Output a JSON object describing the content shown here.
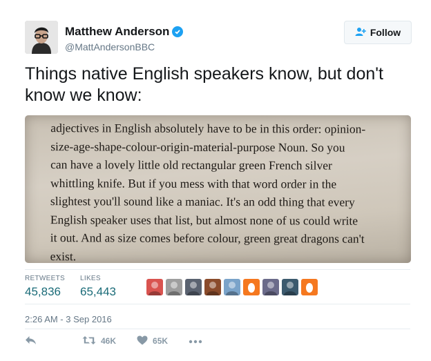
{
  "user": {
    "name": "Matthew Anderson",
    "handle": "@MattAndersonBBC",
    "follow_label": "Follow"
  },
  "tweet": {
    "text": "Things native English speakers know, but don't know we know:"
  },
  "photo": {
    "lines": [
      "adjectives in English absolutely have to be in this order: opinion-",
      "size-age-shape-colour-origin-material-purpose Noun. So you",
      "can have a lovely little old rectangular green French silver",
      "whittling knife. But if you mess with that word order in the",
      "slightest you'll sound like a maniac. It's an odd thing that every",
      "English speaker uses that list, but almost none of us could write",
      "it out. And as size comes before colour, green great dragons can't",
      "exist."
    ]
  },
  "stats": {
    "retweets_label": "RETWEETS",
    "retweets_value": "45,836",
    "likes_label": "LIKES",
    "likes_value": "65,443"
  },
  "likers": [
    {
      "icon": "liker-avatar",
      "color": "#d9534f"
    },
    {
      "icon": "liker-avatar",
      "color": "#9e9e9e"
    },
    {
      "icon": "liker-avatar",
      "color": "#5a6270"
    },
    {
      "icon": "liker-avatar",
      "color": "#8a4b2b"
    },
    {
      "icon": "liker-avatar",
      "color": "#7aa3c9"
    },
    {
      "icon": "egg-icon",
      "color": "#f5781f"
    },
    {
      "icon": "liker-avatar",
      "color": "#6b6b8a"
    },
    {
      "icon": "liker-avatar",
      "color": "#3c5a6e"
    },
    {
      "icon": "egg-icon",
      "color": "#f5781f"
    }
  ],
  "timestamp": "2:26 AM - 3 Sep 2016",
  "actions": {
    "retweet_count": "46K",
    "like_count": "65K"
  },
  "colors": {
    "accent": "#1da1f2",
    "stat_value": "#1a6b78",
    "muted": "#657786"
  }
}
